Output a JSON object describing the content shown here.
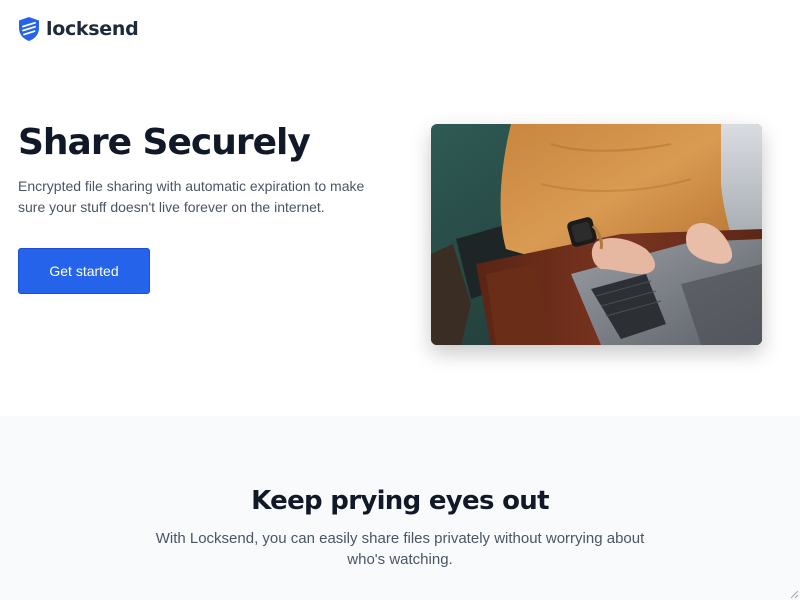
{
  "brand": {
    "name": "locksend",
    "icon": "shield-icon",
    "color": "#2563eb"
  },
  "hero": {
    "title": "Share Securely",
    "subtitle": "Encrypted file sharing with automatic expiration to make sure your stuff doesn't live forever on the internet.",
    "cta_label": "Get started",
    "image": "laptop-typing-photo"
  },
  "feature": {
    "title": "Keep prying eyes out",
    "text": "With Locksend, you can easily share files privately without worrying about who's watching."
  },
  "colors": {
    "primary": "#2563eb",
    "heading": "#111827",
    "body": "#4b5563",
    "section_bg": "#f8fafc"
  }
}
